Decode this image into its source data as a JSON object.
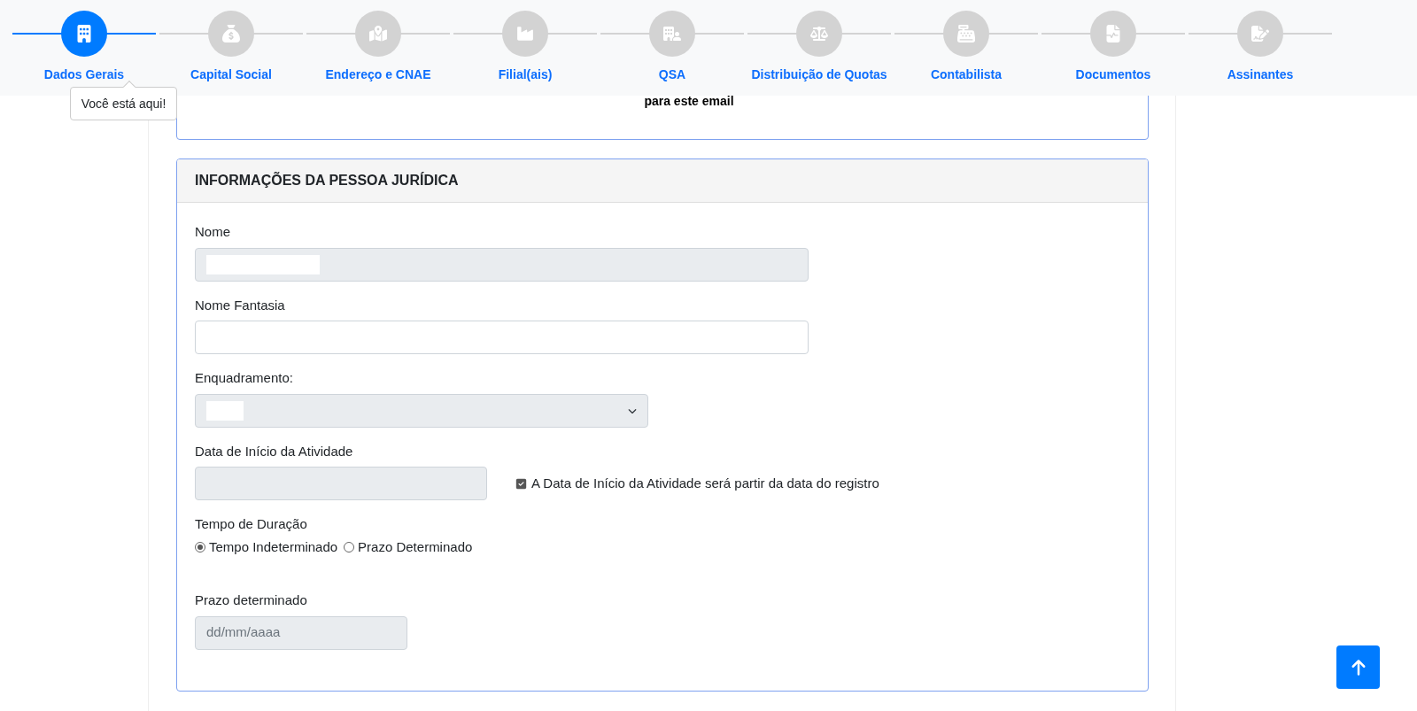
{
  "steps": [
    {
      "label": "Dados Gerais",
      "selected": true
    },
    {
      "label": "Capital Social",
      "selected": false
    },
    {
      "label": "Endereço e CNAE",
      "selected": false
    },
    {
      "label": "Filial(ais)",
      "selected": false
    },
    {
      "label": "QSA",
      "selected": false
    },
    {
      "label": "Distribuição de Quotas",
      "selected": false
    },
    {
      "label": "Contabilista",
      "selected": false
    },
    {
      "label": "Documentos",
      "selected": false
    },
    {
      "label": "Assinantes",
      "selected": false
    }
  ],
  "tooltip": "Você está aqui!",
  "top_card": {
    "text": "para este email"
  },
  "section": {
    "title": "INFORMAÇÕES DA PESSOA JURÍDICA",
    "fields": [
      {
        "kind": "text",
        "label": "Nome",
        "disabled": true,
        "redacted": true
      },
      {
        "kind": "text",
        "label": "Nome Fantasia",
        "disabled": false
      },
      {
        "kind": "select",
        "label": "Enquadramento:",
        "disabled": true,
        "redacted": true
      },
      {
        "kind": "date_with_check",
        "label": "Data de Início da Atividade",
        "disabled": true,
        "check": {
          "label": "A Data de Início da Atividade será partir da data do registro",
          "checked": true
        }
      },
      {
        "kind": "radio",
        "label": "Tempo de Duração",
        "options": [
          {
            "label": "Tempo Indeterminado",
            "selected": true
          },
          {
            "label": "Prazo Determinado",
            "selected": false
          }
        ]
      },
      {
        "kind": "text",
        "label": "Prazo determinado",
        "disabled": true,
        "placeholder": "dd/mm/aaaa"
      }
    ]
  }
}
